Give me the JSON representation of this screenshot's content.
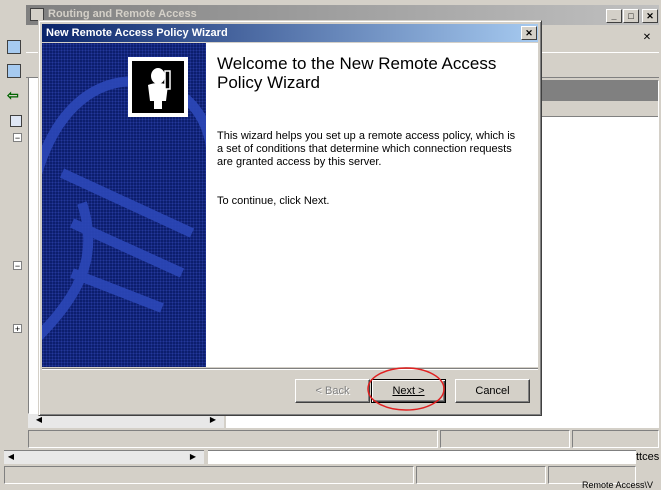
{
  "background_window": {
    "title": "Routing and Remote Access",
    "partial_text_1": "ttces",
    "partial_text_2": "Remote Access\\V"
  },
  "wizard": {
    "title": "New Remote Access Policy Wizard",
    "heading": "Welcome to the New Remote Access Policy Wizard",
    "description": "This wizard helps you set up a remote access policy, which is a set of conditions that determine which connection requests are granted access by this server.",
    "continue_text": "To continue, click Next.",
    "buttons": {
      "back": "< Back",
      "next": "Next >",
      "cancel": "Cancel"
    }
  },
  "colors": {
    "title_bar_start": "#0a246a",
    "title_bar_end": "#a6caf0",
    "side_panel": "#0c1e6e",
    "annotation_circle": "#e02020"
  },
  "icons": [
    "minimize-icon",
    "maximize-icon",
    "close-icon",
    "wizard-person-icon",
    "tree-expand-icon",
    "tree-collapse-icon"
  ]
}
